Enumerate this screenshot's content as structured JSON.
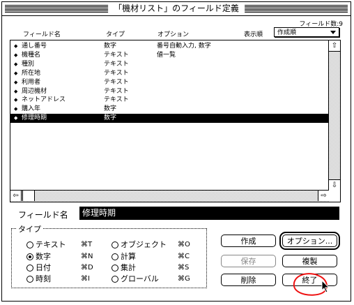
{
  "window": {
    "title": "「機材リスト」のフィールド定義"
  },
  "field_count": "フィールド数:9",
  "columns": {
    "name": "フィールド名",
    "type": "タイプ",
    "options": "オプション"
  },
  "sort": {
    "label": "表示順",
    "selected": "作成順"
  },
  "fields": [
    {
      "name": "通し番号",
      "type": "数字",
      "options": "番号自動入力, 数字",
      "selected": false
    },
    {
      "name": "機種名",
      "type": "テキスト",
      "options": "値一覧",
      "selected": false
    },
    {
      "name": "種別",
      "type": "テキスト",
      "options": "",
      "selected": false
    },
    {
      "name": "所在地",
      "type": "テキスト",
      "options": "",
      "selected": false
    },
    {
      "name": "利用者",
      "type": "テキスト",
      "options": "",
      "selected": false
    },
    {
      "name": "周辺機材",
      "type": "テキスト",
      "options": "",
      "selected": false
    },
    {
      "name": "ネットアドレス",
      "type": "テキスト",
      "options": "",
      "selected": false
    },
    {
      "name": "購入年",
      "type": "数字",
      "options": "",
      "selected": false
    },
    {
      "name": "修理時期",
      "type": "数字",
      "options": "",
      "selected": true
    }
  ],
  "field_name": {
    "label": "フィールド名",
    "value": "修理時期"
  },
  "type_group": {
    "title": "タイプ",
    "options": [
      {
        "label": "テキスト",
        "shortcut": "⌘T",
        "checked": false
      },
      {
        "label": "数字",
        "shortcut": "⌘N",
        "checked": true
      },
      {
        "label": "日付",
        "shortcut": "⌘D",
        "checked": false
      },
      {
        "label": "時刻",
        "shortcut": "⌘I",
        "checked": false
      },
      {
        "label": "オブジェクト",
        "shortcut": "⌘O",
        "checked": false
      },
      {
        "label": "計算",
        "shortcut": "⌘C",
        "checked": false
      },
      {
        "label": "集計",
        "shortcut": "⌘S",
        "checked": false
      },
      {
        "label": "グローバル",
        "shortcut": "⌘G",
        "checked": false
      }
    ]
  },
  "buttons": {
    "create": "作成",
    "options": "オプション...",
    "save": "保存",
    "duplicate": "複製",
    "delete": "削除",
    "done": "終了"
  },
  "icons": {
    "row_handle": "updown-diamond-icon",
    "scroll_up": "up-arrow-icon",
    "scroll_down": "down-arrow-icon",
    "scroll_left": "left-arrow-icon",
    "scroll_right": "right-arrow-icon"
  }
}
